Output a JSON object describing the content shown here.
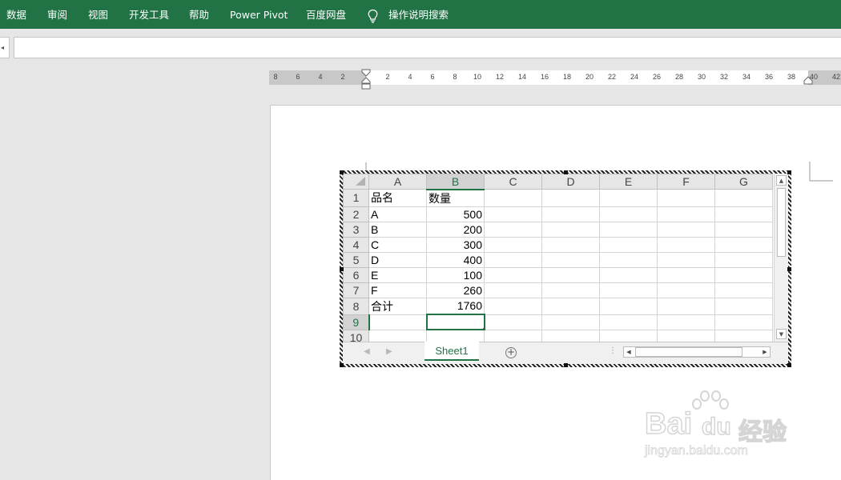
{
  "ribbon": {
    "tabs": [
      "数据",
      "审阅",
      "视图",
      "开发工具",
      "帮助",
      "Power Pivot",
      "百度网盘"
    ],
    "tell_me": "操作说明搜索",
    "tell_me_icon": "lightbulb-icon",
    "accent": "#217346"
  },
  "ruler": {
    "left_labels": [
      "8",
      "6",
      "4",
      "2"
    ],
    "right_labels": [
      "2",
      "4",
      "6",
      "8",
      "10",
      "12",
      "14",
      "16",
      "18",
      "20",
      "22",
      "24",
      "26",
      "28",
      "30",
      "32",
      "34",
      "36",
      "38",
      "40",
      "42"
    ]
  },
  "spreadsheet": {
    "columns": [
      "A",
      "B",
      "C",
      "D",
      "E",
      "F",
      "G"
    ],
    "selected_column": "B",
    "selected_row": "9",
    "rows": [
      {
        "n": "1",
        "a": "品名",
        "b": "数量"
      },
      {
        "n": "2",
        "a": "A",
        "b": "500"
      },
      {
        "n": "3",
        "a": "B",
        "b": "200"
      },
      {
        "n": "4",
        "a": "C",
        "b": "300"
      },
      {
        "n": "5",
        "a": "D",
        "b": "400"
      },
      {
        "n": "6",
        "a": "E",
        "b": "100"
      },
      {
        "n": "7",
        "a": "F",
        "b": "260"
      },
      {
        "n": "8",
        "a": "合计",
        "b": "1760"
      },
      {
        "n": "9",
        "a": "",
        "b": ""
      },
      {
        "n": "10",
        "a": "",
        "b": ""
      }
    ],
    "sheet_tab": "Sheet1",
    "add_sheet_icon": "plus-circle-icon"
  },
  "watermark": {
    "brand": "Bai",
    "brand2": "du",
    "product": "经验",
    "url": "jingyan.baidu.com"
  }
}
